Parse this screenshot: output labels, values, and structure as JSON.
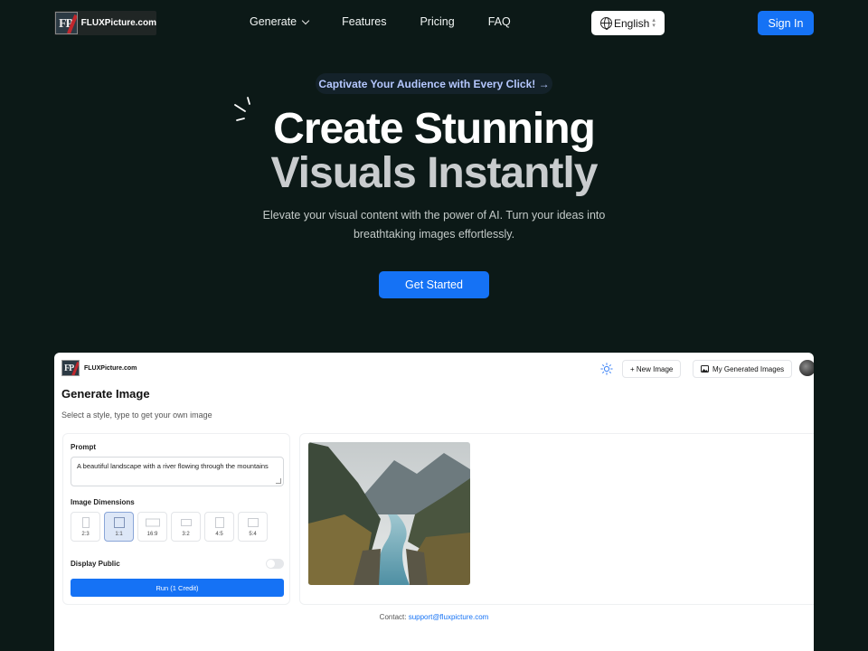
{
  "nav": {
    "logo_text": "FLUXPicture.com",
    "links": [
      "Generate",
      "Features",
      "Pricing",
      "FAQ"
    ],
    "language": "English",
    "signin_label": "Sign In"
  },
  "hero": {
    "pill_text": "Captivate Your Audience with Every Click! →",
    "title_line1": "Create Stunning",
    "title_line2": "Visuals Instantly",
    "subtitle": "Elevate your visual content with the power of AI. Turn your ideas into breathtaking images effortlessly.",
    "cta_label": "Get Started"
  },
  "app": {
    "logo_text": "FLUXPicture.com",
    "new_image_label": "+ New Image",
    "my_images_label": "My Generated Images",
    "title": "Generate Image",
    "subtitle": "Select a style, type to get your own image",
    "prompt_label": "Prompt",
    "prompt_value": "A beautiful landscape with a river flowing through the mountains",
    "dimensions_label": "Image Dimensions",
    "dimensions": [
      "2:3",
      "1:1",
      "16:9",
      "3:2",
      "4:5",
      "5:4"
    ],
    "selected_dimension": "1:1",
    "display_public_label": "Display Public",
    "run_label": "Run (1 Credit)",
    "contact_label": "Contact:",
    "contact_email": "support@fluxpicture.com"
  },
  "colors": {
    "background": "#0c1917",
    "accent": "#1572f5"
  },
  "icons": {
    "language": "globe-icon",
    "theme": "sun-icon",
    "my_images": "image-icon",
    "dropdown": "chevron-down-icon"
  }
}
